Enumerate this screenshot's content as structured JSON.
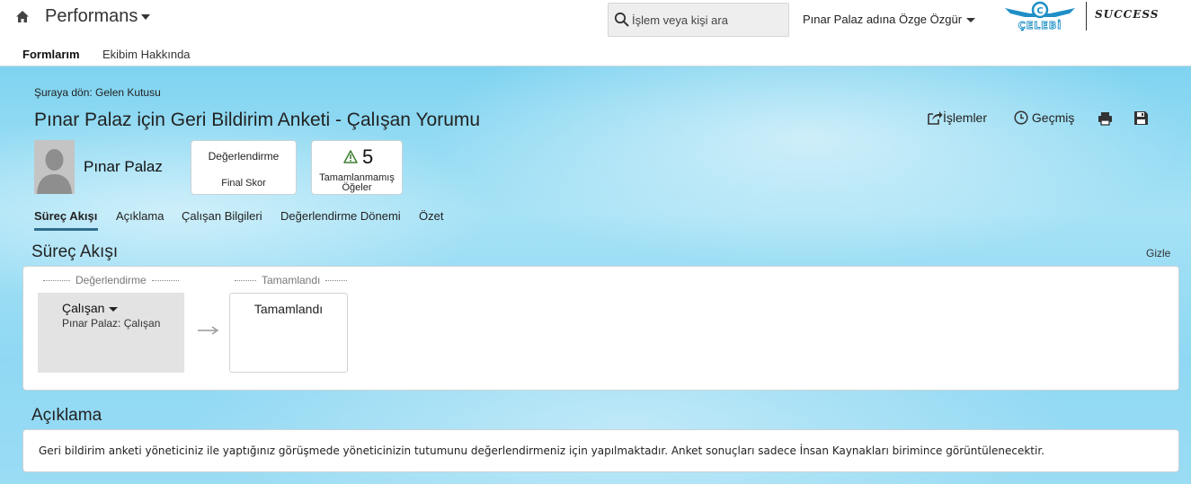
{
  "header": {
    "app_title": "Performans",
    "search_placeholder": "İşlem veya kişi ara",
    "user_menu": "Pınar Palaz adına Özge Özgür",
    "brand_logo_text": "ÇELEBİ",
    "product_logo_text": "SUCCESS"
  },
  "subnav": {
    "tabs": [
      {
        "label": "Formlarım",
        "active": true
      },
      {
        "label": "Ekibim Hakkında",
        "active": false
      }
    ]
  },
  "page": {
    "back_link": "Şuraya dön: Gelen Kutusu",
    "title": "Pınar Palaz için Geri Bildirim Anketi - Çalışan Yorumu",
    "actions": {
      "islemler": "İşlemler",
      "gecmis": "Geçmiş",
      "print_icon": "print-icon",
      "save_icon": "save-icon"
    },
    "person_name": "Pınar Palaz",
    "eval_card": {
      "line1": "Değerlendirme",
      "line2": "Final Skor"
    },
    "incomplete_card": {
      "count": "5",
      "label": "Tamamlanmamış Öğeler"
    }
  },
  "section_tabs": [
    {
      "label": "Süreç Akışı",
      "active": true
    },
    {
      "label": "Açıklama",
      "active": false
    },
    {
      "label": "Çalışan Bilgileri",
      "active": false
    },
    {
      "label": "Değerlendirme Dönemi",
      "active": false
    },
    {
      "label": "Özet",
      "active": false
    }
  ],
  "process_flow": {
    "heading": "Süreç Akışı",
    "hide_link": "Gizle",
    "steps": [
      {
        "stage_label": "Değerlendirme",
        "role": "Çalışan",
        "assignee": "Pınar Palaz: Çalışan",
        "current": true
      },
      {
        "stage_label": "Tamamlandı",
        "box_label": "Tamamlandı",
        "current": false
      }
    ]
  },
  "description": {
    "heading": "Açıklama",
    "text": "Geri bildirim anketi yöneticiniz ile yaptığınız görüşmede yöneticinizin tutumunu değerlendirmeniz için yapılmaktadır. Anket sonuçları sadece İnsan Kaynakları birimince görüntülenecektir."
  },
  "colors": {
    "background_top": "#7fd3f0",
    "accent_underline": "#2f6d8c",
    "warning": "#3a7d2e",
    "logo_blue": "#1f8fc6"
  }
}
